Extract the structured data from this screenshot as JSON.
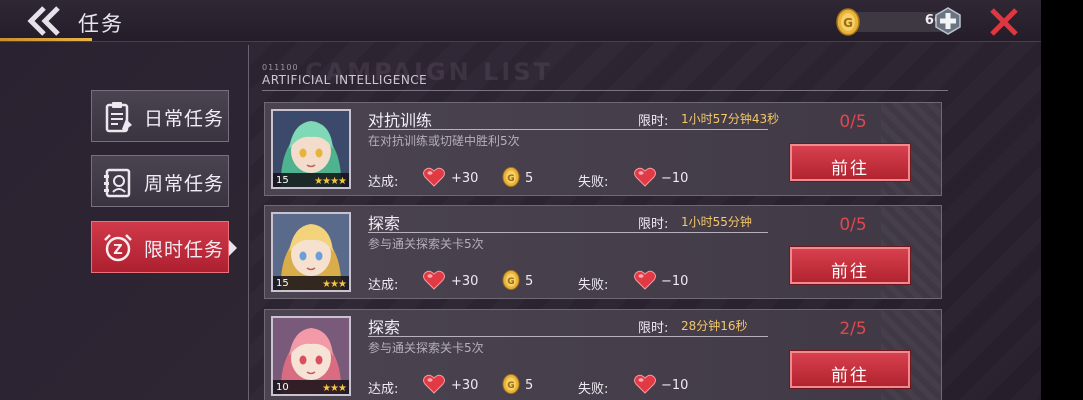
{
  "header": {
    "title": "任务",
    "coin_value": "66"
  },
  "nav": [
    {
      "label": "日常任务",
      "icon": "clipboard-icon",
      "active": false
    },
    {
      "label": "周常任务",
      "icon": "calendar-icon",
      "active": false
    },
    {
      "label": "限时任务",
      "icon": "alarm-clock-icon",
      "active": true
    }
  ],
  "section": {
    "code": "011100",
    "title": "ARTIFICIAL INTELLIGENCE",
    "watermark": "CAMPAIGN LIST"
  },
  "tasks": [
    {
      "name": "对抗训练",
      "desc": "在对抗训练或切磋中胜利5次",
      "limit_label": "限时:",
      "limit_value": "1小时57分钟43秒",
      "progress": "0/5",
      "go_label": "前往",
      "success_label": "达成:",
      "success_reward": "+30",
      "coin_reward": "5",
      "fail_label": "失败:",
      "fail_penalty": "−10",
      "level": "15",
      "stars": "★★★★",
      "portrait_theme": "green-hair"
    },
    {
      "name": "探索",
      "desc": "参与通关探索关卡5次",
      "limit_label": "限时:",
      "limit_value": "1小时55分钟",
      "progress": "0/5",
      "go_label": "前往",
      "success_label": "达成:",
      "success_reward": "+30",
      "coin_reward": "5",
      "fail_label": "失败:",
      "fail_penalty": "−10",
      "level": "15",
      "stars": "★★★",
      "portrait_theme": "blonde-hair"
    },
    {
      "name": "探索",
      "desc": "参与通关探索关卡5次",
      "limit_label": "限时:",
      "limit_value": "28分钟16秒",
      "progress": "2/5",
      "go_label": "前往",
      "success_label": "达成:",
      "success_reward": "+30",
      "coin_reward": "5",
      "fail_label": "失败:",
      "fail_penalty": "−10",
      "level": "10",
      "stars": "★★★",
      "portrait_theme": "pink-hair"
    }
  ],
  "colors": {
    "accent_red": "#c8303d",
    "gold": "#f3c76a",
    "progress_red": "#e0484f"
  }
}
